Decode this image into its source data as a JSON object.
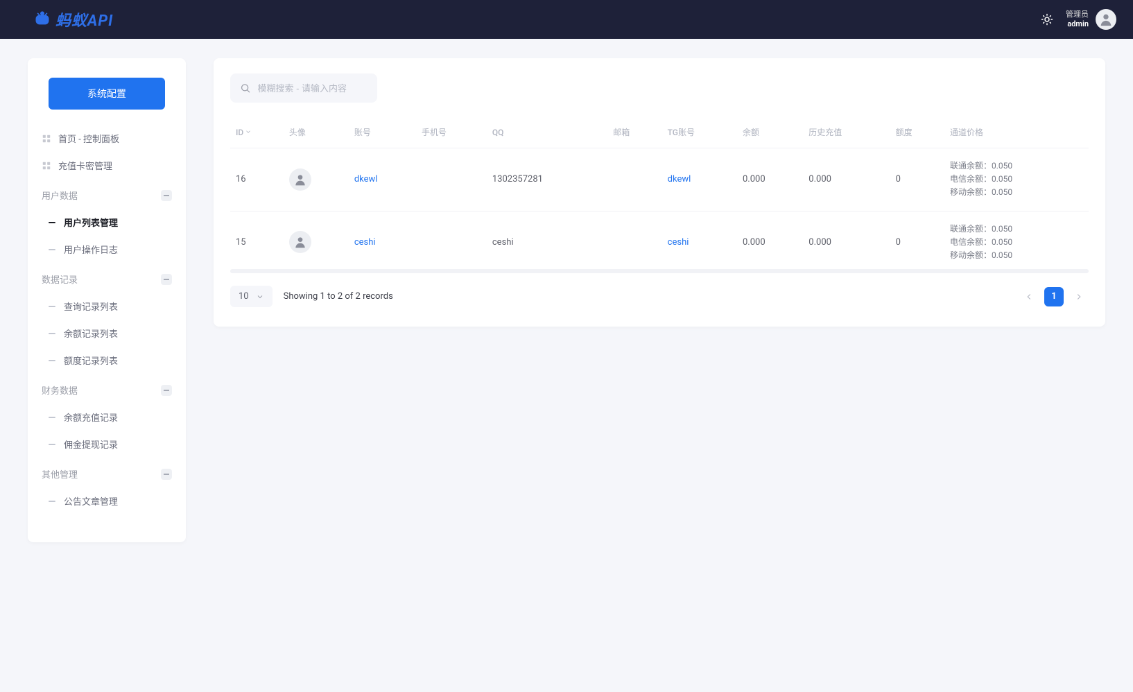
{
  "header": {
    "logo_text": "蚂蚁API",
    "user_role": "管理员",
    "user_name": "admin"
  },
  "sidebar": {
    "system_config": "系统配置",
    "top_items": [
      {
        "label": "首页 - 控制面板"
      },
      {
        "label": "充值卡密管理"
      }
    ],
    "groups": [
      {
        "title": "用户数据",
        "items": [
          {
            "label": "用户列表管理",
            "active": true
          },
          {
            "label": "用户操作日志"
          }
        ]
      },
      {
        "title": "数据记录",
        "items": [
          {
            "label": "查询记录列表"
          },
          {
            "label": "余额记录列表"
          },
          {
            "label": "额度记录列表"
          }
        ]
      },
      {
        "title": "财务数据",
        "items": [
          {
            "label": "余额充值记录"
          },
          {
            "label": "佣金提现记录"
          }
        ]
      },
      {
        "title": "其他管理",
        "items": [
          {
            "label": "公告文章管理"
          }
        ]
      }
    ]
  },
  "search": {
    "placeholder": "模糊搜索 - 请输入内容"
  },
  "table": {
    "columns": [
      "ID",
      "头像",
      "账号",
      "手机号",
      "QQ",
      "邮箱",
      "TG账号",
      "余额",
      "历史充值",
      "额度",
      "通道价格"
    ],
    "rows": [
      {
        "id": "16",
        "account": "dkewl",
        "phone": "",
        "qq": "1302357281",
        "email": "",
        "tg": "dkewl",
        "balance": "0.000",
        "history": "0.000",
        "quota": "0",
        "prices": [
          "联通余额：0.050",
          "电信余额：0.050",
          "移动余额：0.050"
        ]
      },
      {
        "id": "15",
        "account": "ceshi",
        "phone": "",
        "qq": "ceshi",
        "email": "",
        "tg": "ceshi",
        "balance": "0.000",
        "history": "0.000",
        "quota": "0",
        "prices": [
          "联通余额：0.050",
          "电信余额：0.050",
          "移动余额：0.050"
        ]
      }
    ]
  },
  "footer": {
    "page_size": "10",
    "records_text": "Showing 1 to 2 of 2 records",
    "current_page": "1"
  }
}
